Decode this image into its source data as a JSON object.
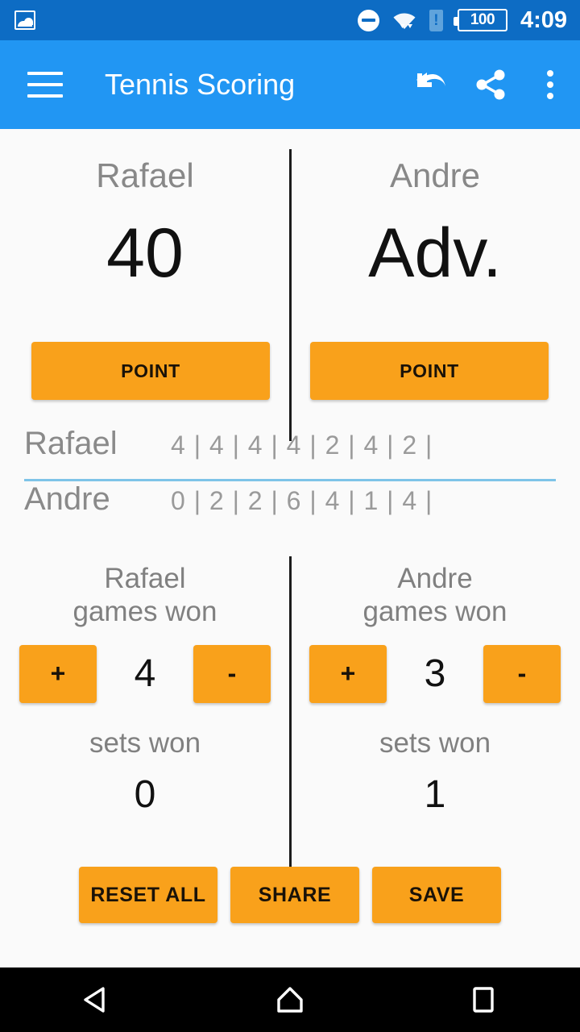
{
  "status_bar": {
    "image_icon": "image-icon",
    "dnd_icon": "do-not-disturb-icon",
    "wifi_icon": "wifi-icon",
    "sim_icon": "sim-card-alert-icon",
    "battery_level": "100",
    "time": "4:09"
  },
  "toolbar": {
    "menu_icon": "hamburger-menu-icon",
    "title": "Tennis Scoring",
    "undo_icon": "undo-icon",
    "share_icon": "share-icon",
    "overflow_icon": "overflow-menu-icon"
  },
  "match": {
    "players": [
      {
        "name": "Rafael",
        "current_point": "40",
        "point_label": "POINT"
      },
      {
        "name": "Andre",
        "current_point": "Adv.",
        "point_label": "POINT"
      }
    ],
    "history": [
      {
        "name": "Rafael",
        "scores": "4 | 4 | 4 | 4 | 2 | 4 | 2 |"
      },
      {
        "name": "Andre",
        "scores": "0 | 2 | 2 | 6 | 4 | 1 | 4 |"
      }
    ],
    "games": [
      {
        "label": "Rafael\ngames won",
        "plus": "+",
        "minus": "-",
        "count": "4",
        "sets_label": "sets won",
        "sets_count": "0"
      },
      {
        "label": "Andre\ngames won",
        "plus": "+",
        "minus": "-",
        "count": "3",
        "sets_label": "sets won",
        "sets_count": "1"
      }
    ]
  },
  "actions": {
    "reset": "RESET ALL",
    "share": "SHARE",
    "save": "SAVE"
  },
  "navbar": {
    "back": "back-icon",
    "home": "home-icon",
    "recents": "recents-icon"
  },
  "colors": {
    "status_bar": "#0D6CC4",
    "toolbar": "#2196F3",
    "accent_button": "#F9A11B",
    "background": "#FAFAFA",
    "underline": "#7EC4E8",
    "divider": "#1B1B1B",
    "muted_text": "#888888"
  }
}
